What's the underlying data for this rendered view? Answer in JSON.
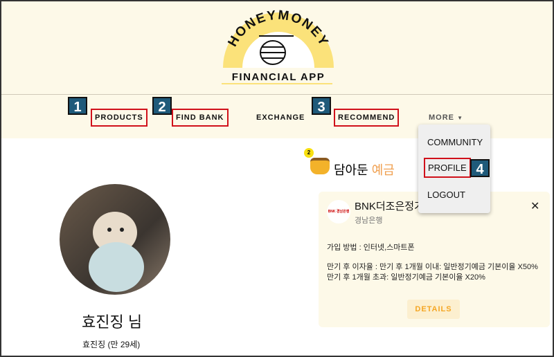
{
  "header": {
    "logo_text_top": "HONEYMONEY",
    "logo_text_bottom": "FINANCIAL APP"
  },
  "nav": {
    "items": [
      {
        "label": "PRODUCTS",
        "badge": "1"
      },
      {
        "label": "FIND BANK",
        "badge": "2"
      },
      {
        "label": "EXCHANGE"
      },
      {
        "label": "RECOMMEND",
        "badge": "3"
      },
      {
        "label": "MORE"
      }
    ]
  },
  "more_menu": {
    "items": [
      "COMMUNITY",
      "PROFILE",
      "LOGOUT"
    ],
    "profile_badge": "4"
  },
  "profile": {
    "name": "효진징 님",
    "subtitle": "효진징 (만 29세)"
  },
  "saved": {
    "count": "2",
    "title_a": "담아둔",
    "title_b": "예금"
  },
  "card": {
    "product": "BNK더조은정기",
    "bank": "경남은행",
    "bank_logo": "BNK 경남은행",
    "join_method": "가입 방법 : 인터넷,스마트폰",
    "rate_line1": "만기 후 이자율 : 만기 후 1개월 이내: 일반정기예금 기본이율 X50%",
    "rate_line2": "만기 후 1개월 초과: 일반정기예금 기본이율 X20%",
    "details_label": "DETAILS",
    "close": "✕"
  },
  "colors": {
    "header_bg": "#fdf9e8",
    "accent": "#f5a623",
    "highlight": "#d0101a",
    "badge": "#1f5a7a"
  }
}
